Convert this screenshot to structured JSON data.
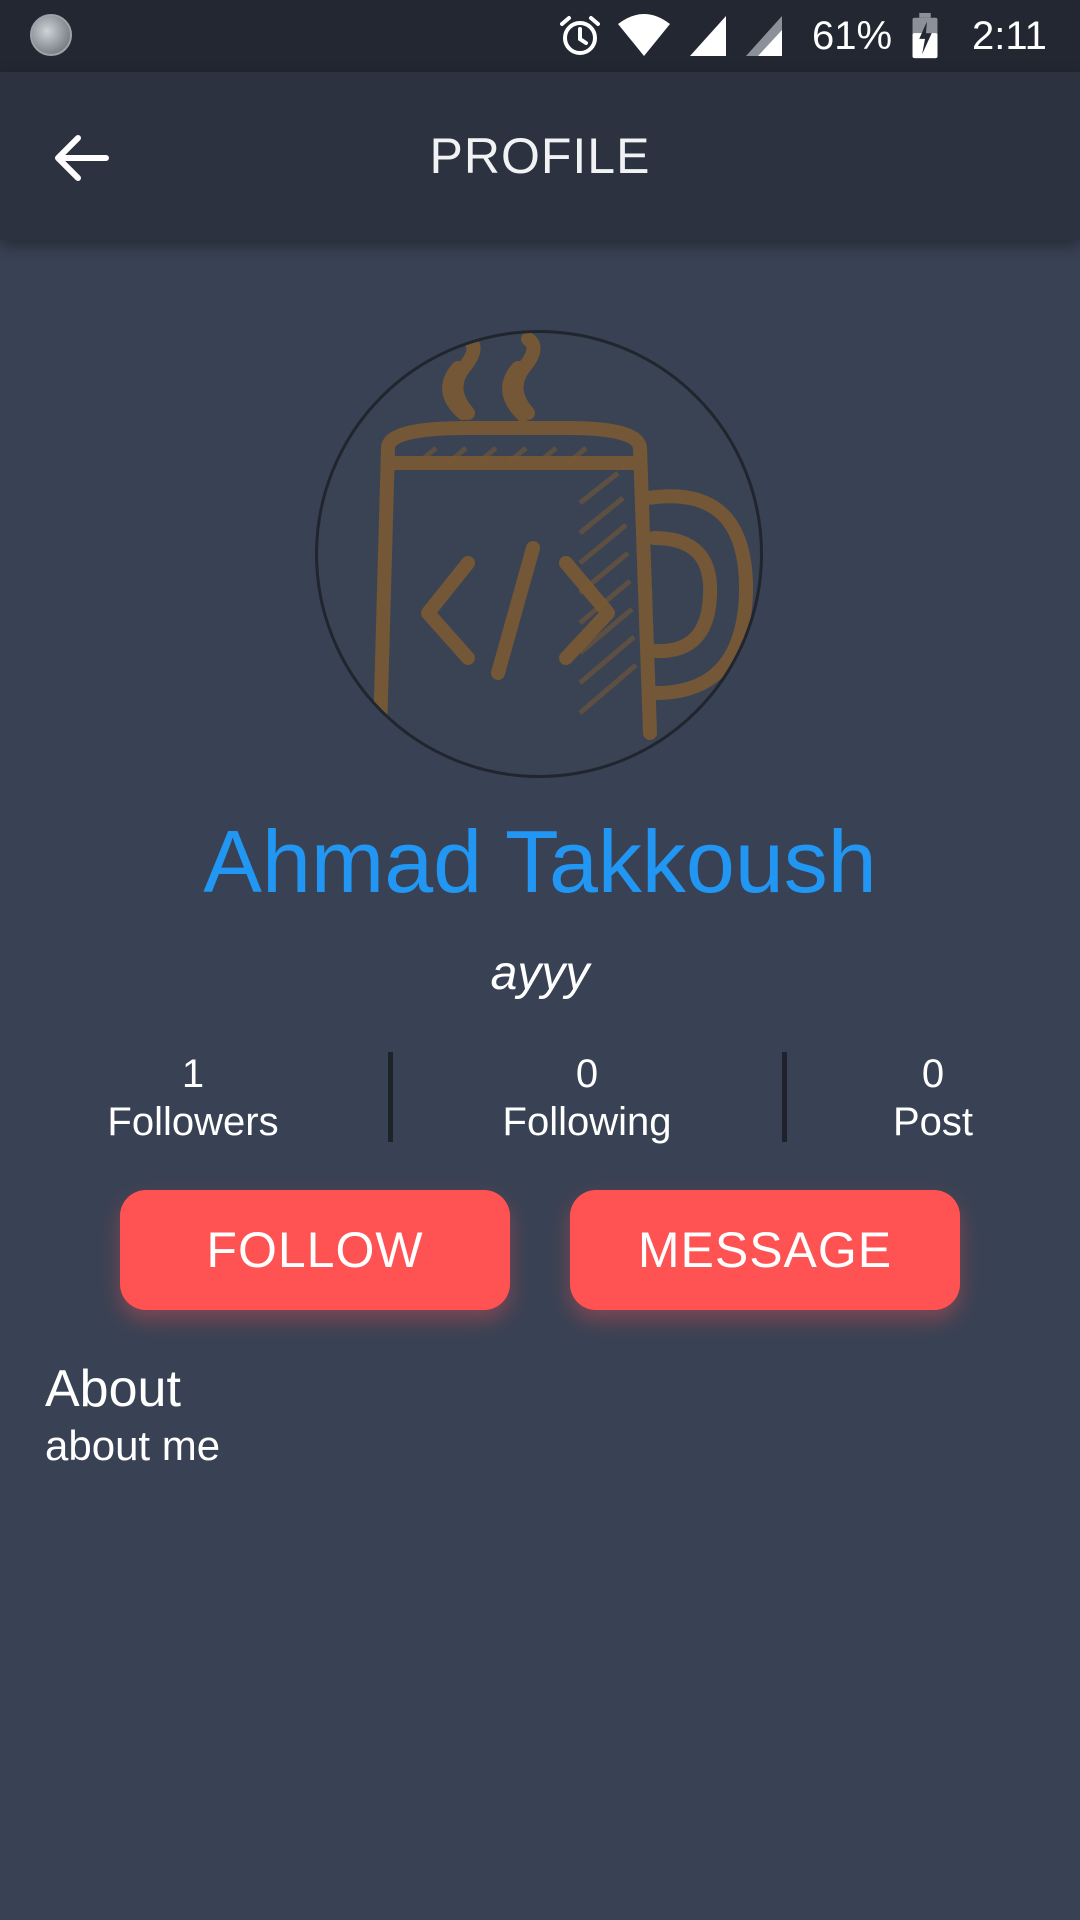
{
  "status_bar": {
    "battery_percent": "61%",
    "time": "2:11",
    "icons": [
      "loading-indicator-icon",
      "alarm-icon",
      "wifi-icon",
      "cell-signal-icon",
      "cell-signal-secondary-icon",
      "battery-charging-icon"
    ]
  },
  "app_bar": {
    "title": "PROFILE",
    "back_icon": "arrow-back-icon"
  },
  "profile": {
    "avatar_icon": "coffee-mug-code-icon",
    "name": "Ahmad Takkoush",
    "status": "ayyy"
  },
  "stats": [
    {
      "value": "1",
      "label": "Followers"
    },
    {
      "value": "0",
      "label": "Following"
    },
    {
      "value": "0",
      "label": "Post"
    }
  ],
  "actions": {
    "follow_label": "FOLLOW",
    "message_label": "MESSAGE"
  },
  "about": {
    "heading": "About",
    "body": "about me"
  },
  "colors": {
    "background": "#394254",
    "app_bar": "#2c3240",
    "status_bar": "#222731",
    "name_accent": "#2196f3",
    "button": "#ff5252",
    "avatar_art": "#7a5a34"
  }
}
